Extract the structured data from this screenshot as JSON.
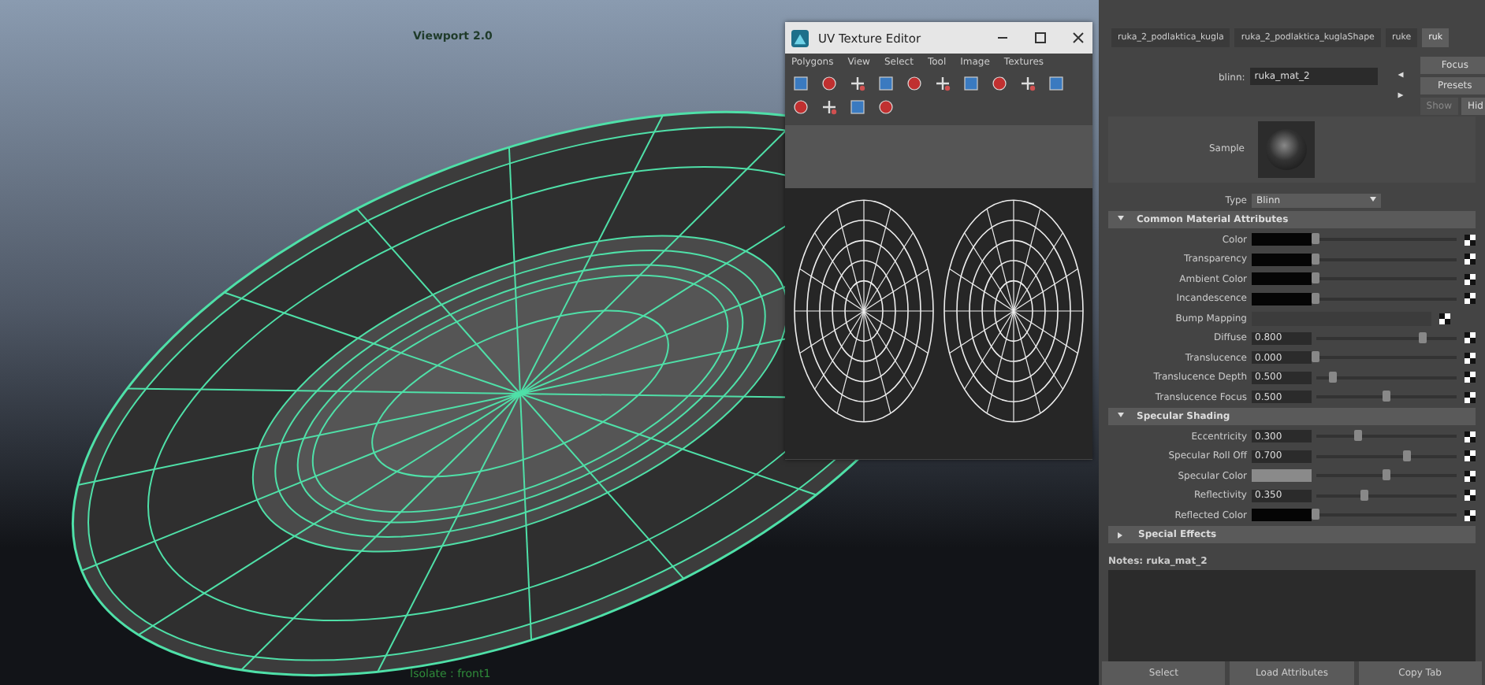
{
  "viewport": {
    "title": "Viewport 2.0",
    "footer": "Isolate : front1"
  },
  "uv_editor": {
    "title": "UV Texture Editor",
    "menu": [
      "Polygons",
      "View",
      "Select",
      "Tool",
      "Image",
      "Textures"
    ]
  },
  "attribute_editor": {
    "tabs": [
      {
        "label": "ruka_2_podlaktica_kugla",
        "selected": false
      },
      {
        "label": "ruka_2_podlaktica_kuglaShape",
        "selected": false
      },
      {
        "label": "ruke",
        "selected": false
      },
      {
        "label": "ruk",
        "selected": true
      }
    ],
    "name_label": "blinn:",
    "name_value": "ruka_mat_2",
    "side_buttons": [
      "Focus",
      "Presets"
    ],
    "show_button": "Show",
    "hide_button": "Hid",
    "sample_label": "Sample",
    "type_label": "Type",
    "type_value": "Blinn",
    "sections": [
      {
        "title": "Common Material Attributes",
        "expanded": true,
        "attributes": [
          {
            "label": "Color",
            "kind": "color",
            "color": "#050505",
            "level": 0.0
          },
          {
            "label": "Transparency",
            "kind": "color",
            "color": "#050505",
            "level": 0.0
          },
          {
            "label": "Ambient Color",
            "kind": "color",
            "color": "#050505",
            "level": 0.0
          },
          {
            "label": "Incandescence",
            "kind": "color",
            "color": "#050505",
            "level": 0.0
          },
          {
            "label": "Bump Mapping",
            "kind": "empty"
          },
          {
            "label": "Diffuse",
            "kind": "number",
            "value": "0.800",
            "level": 0.76
          },
          {
            "label": "Translucence",
            "kind": "number",
            "value": "0.000",
            "level": 0.0
          },
          {
            "label": "Translucence Depth",
            "kind": "number",
            "value": "0.500",
            "level": 0.12
          },
          {
            "label": "Translucence Focus",
            "kind": "number",
            "value": "0.500",
            "level": 0.5
          }
        ]
      },
      {
        "title": "Specular Shading",
        "expanded": true,
        "attributes": [
          {
            "label": "Eccentricity",
            "kind": "number",
            "value": "0.300",
            "level": 0.3
          },
          {
            "label": "Specular Roll Off",
            "kind": "number",
            "value": "0.700",
            "level": 0.65
          },
          {
            "label": "Specular Color",
            "kind": "color",
            "color": "#8a8a8a",
            "level": 0.5
          },
          {
            "label": "Reflectivity",
            "kind": "number",
            "value": "0.350",
            "level": 0.35
          },
          {
            "label": "Reflected Color",
            "kind": "color",
            "color": "#050505",
            "level": 0.0
          }
        ]
      },
      {
        "title": "Special Effects",
        "expanded": false
      }
    ],
    "notes_label": "Notes: ruka_mat_2",
    "buttons": [
      "Select",
      "Load Attributes",
      "Copy Tab"
    ]
  }
}
